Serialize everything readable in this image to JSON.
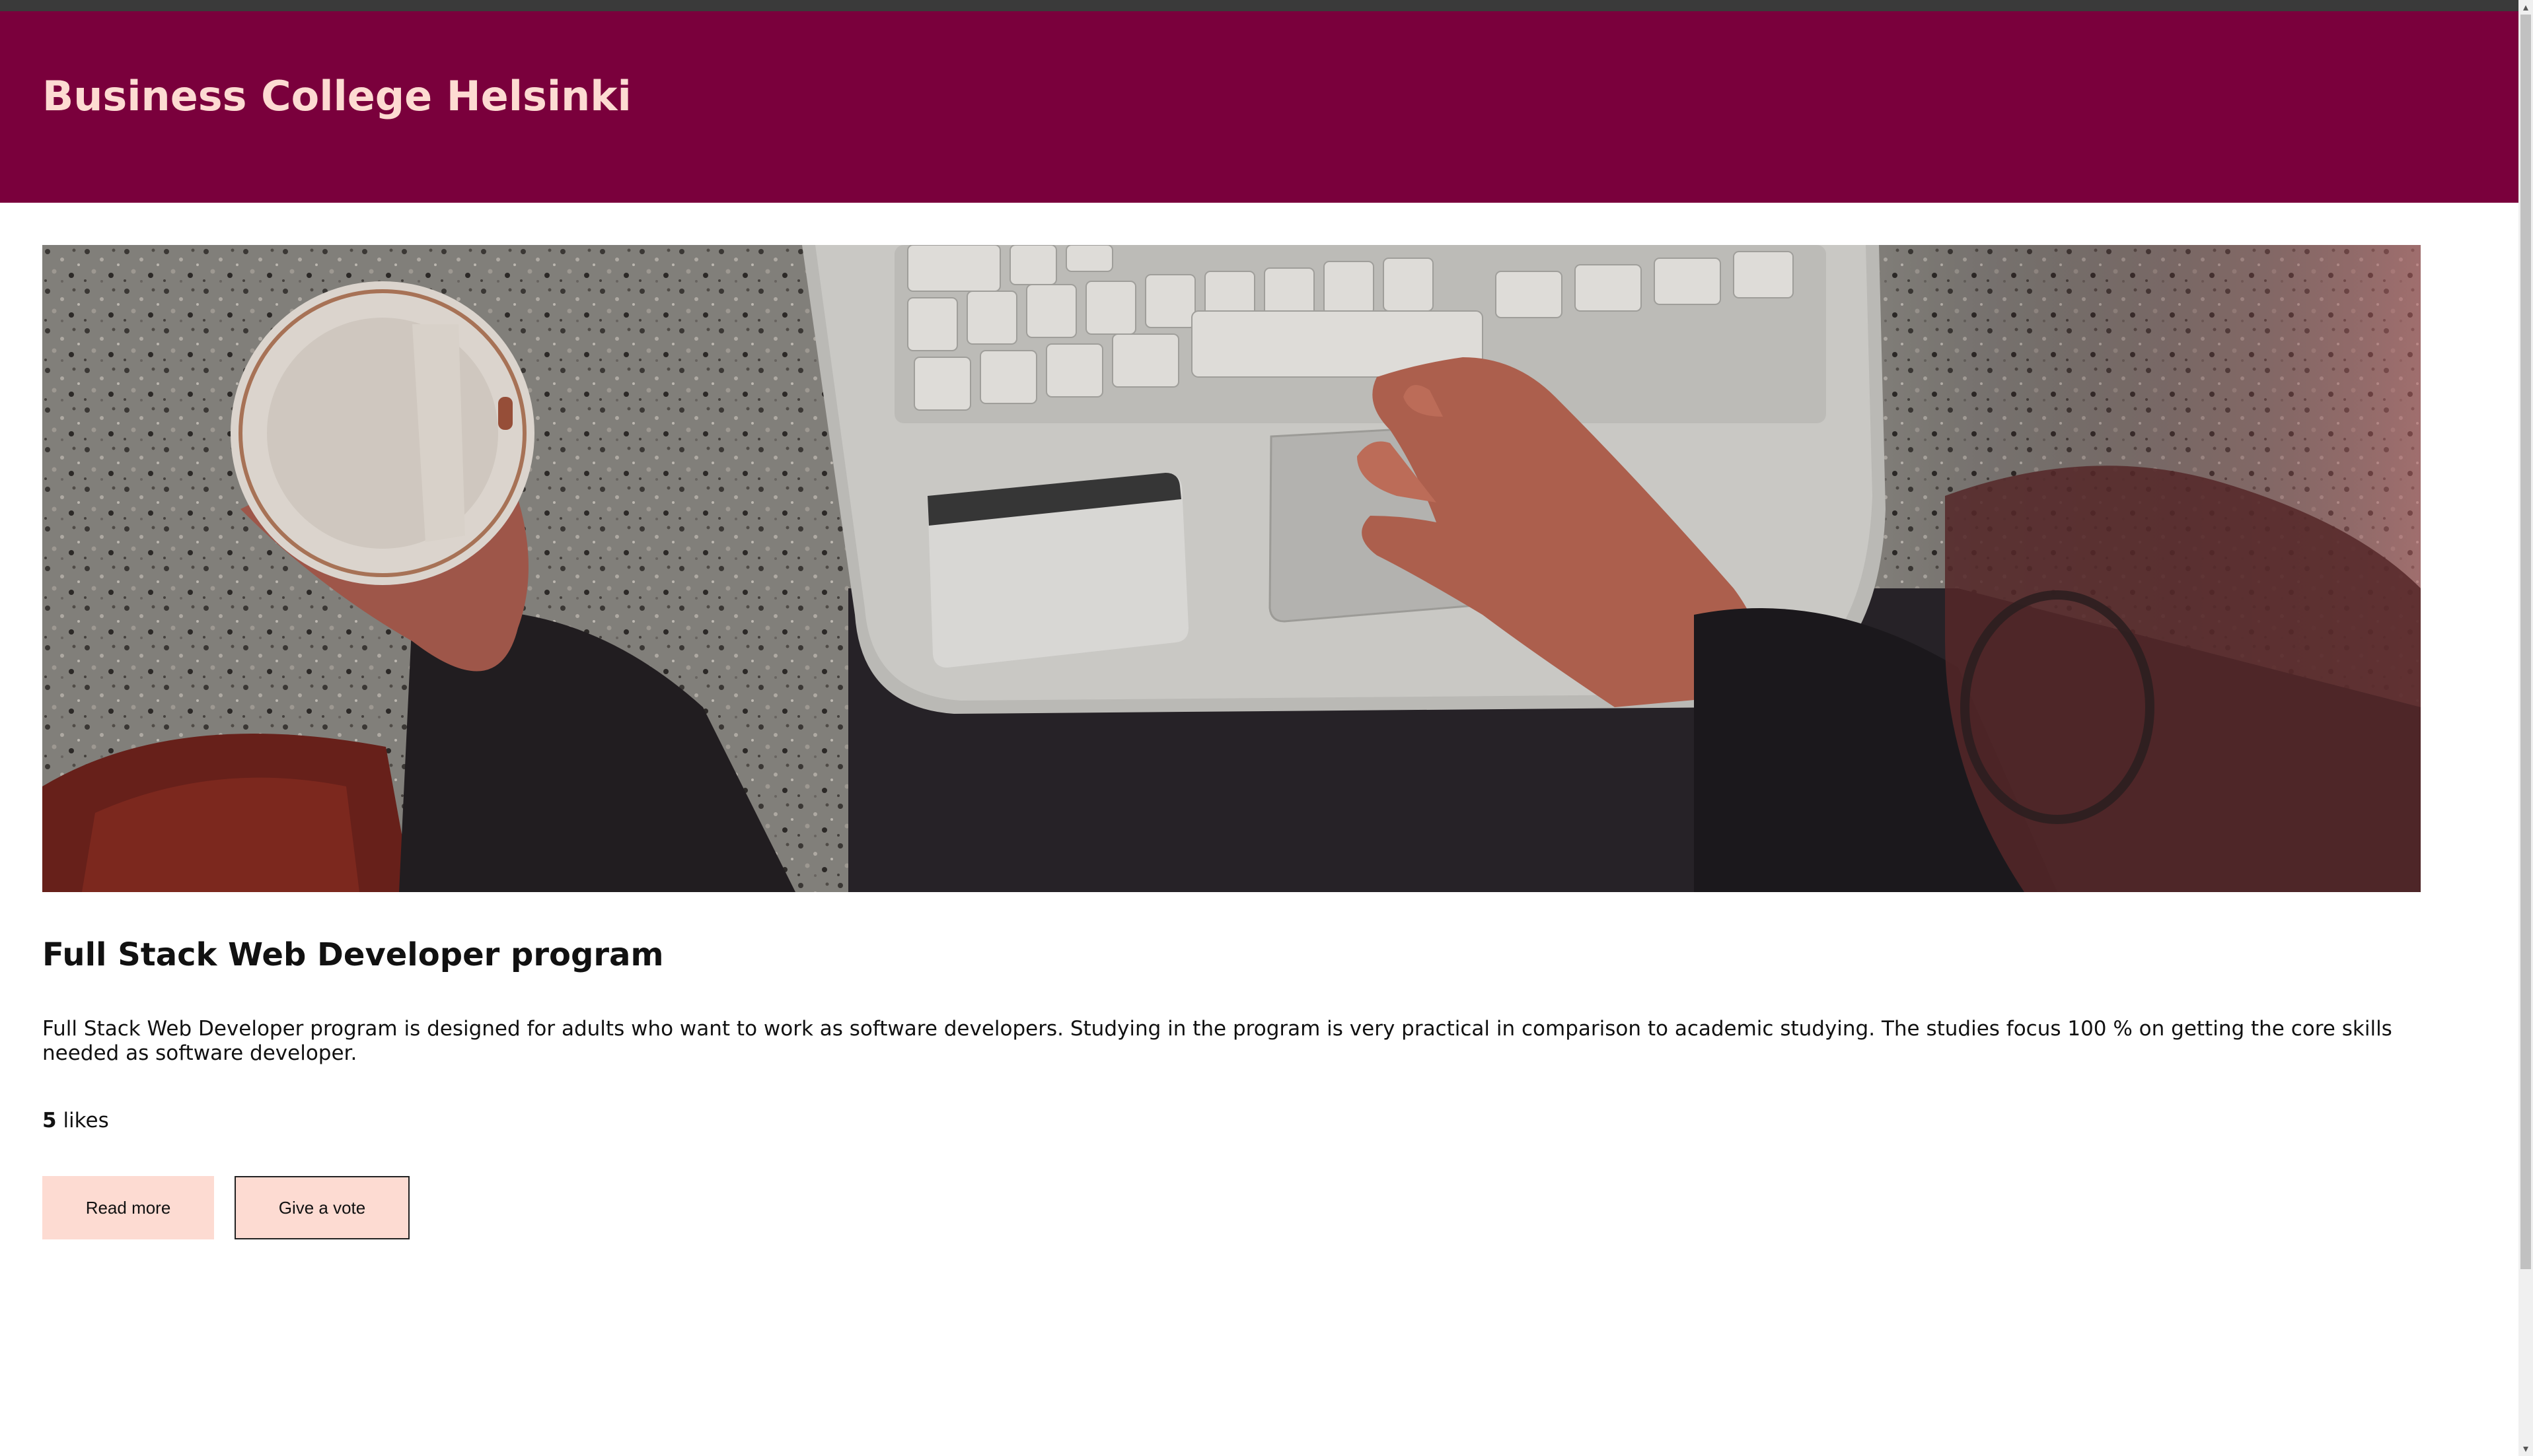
{
  "header": {
    "title": "Business College Helsinki",
    "background_color": "#7a003c",
    "title_color": "#fddbd2"
  },
  "hero": {
    "icon": "laptop-coffee-photo"
  },
  "program": {
    "title": "Full Stack Web Developer program",
    "description": "Full Stack Web Developer program is designed for adults who want to work as software developers. Studying in the program is very practical in comparison to academic studying. The studies focus 100 % on getting the core skills needed as software developer.",
    "likes_count": "5",
    "likes_label": "likes"
  },
  "actions": {
    "read_more_label": "Read more",
    "vote_label": "Give a vote",
    "button_color": "#fddbd2"
  },
  "scrollbar": {
    "up_icon": "chevron-up-icon",
    "down_icon": "chevron-down-icon"
  }
}
